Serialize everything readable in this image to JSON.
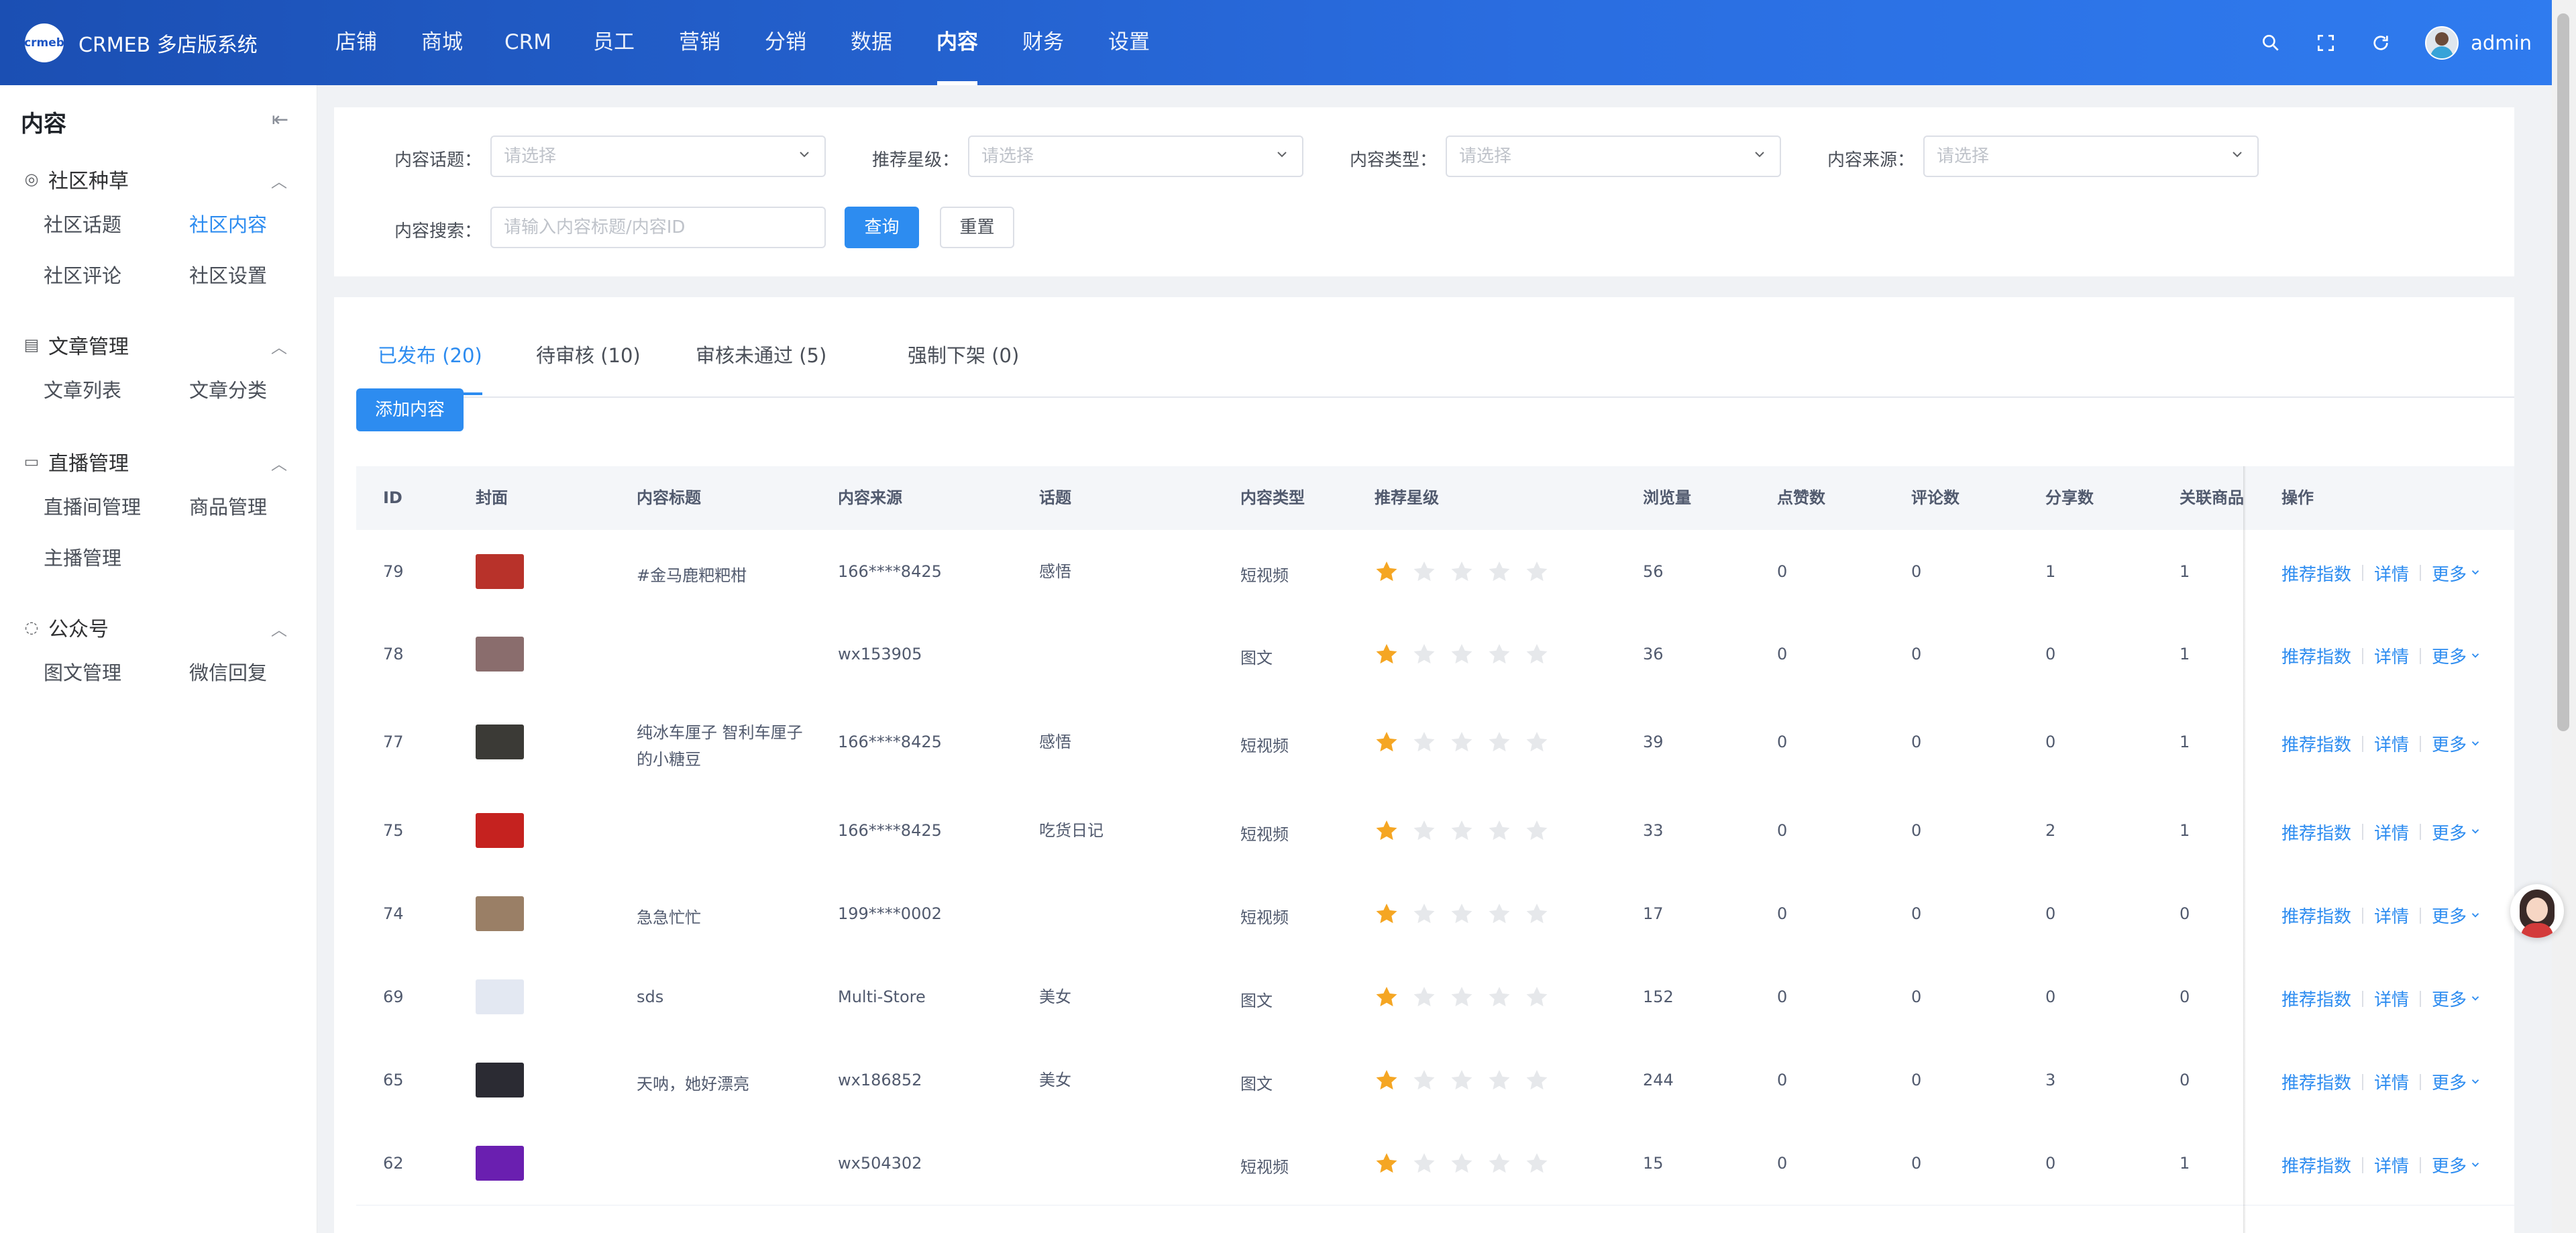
{
  "app": {
    "logo_mark": "crmeb",
    "title": "CRMEB 多店版系统"
  },
  "topnav": [
    "店铺",
    "商城",
    "CRM",
    "员工",
    "营销",
    "分销",
    "数据",
    "内容",
    "财务",
    "设置"
  ],
  "topnav_active": 7,
  "user": {
    "name": "admin"
  },
  "sidebar": {
    "title": "内容",
    "collapse_icon": "⇤",
    "groups": [
      {
        "label": "社区种草",
        "icon": "target-icon",
        "items": [
          "社区话题",
          "社区内容",
          "社区评论",
          "社区设置"
        ],
        "active_index": 1
      },
      {
        "label": "文章管理",
        "icon": "article-icon",
        "items": [
          "文章列表",
          "文章分类"
        ],
        "active_index": -1
      },
      {
        "label": "直播管理",
        "icon": "video-icon",
        "items": [
          "直播间管理",
          "商品管理",
          "主播管理"
        ],
        "active_index": -1
      },
      {
        "label": "公众号",
        "icon": "chat-icon",
        "items": [
          "图文管理",
          "微信回复"
        ],
        "active_index": -1
      }
    ]
  },
  "filters": {
    "topic": {
      "label": "内容话题：",
      "placeholder": "请选择"
    },
    "stars": {
      "label": "推荐星级：",
      "placeholder": "请选择"
    },
    "type": {
      "label": "内容类型：",
      "placeholder": "请选择"
    },
    "source": {
      "label": "内容来源：",
      "placeholder": "请选择"
    },
    "search": {
      "label": "内容搜索：",
      "placeholder": "请输入内容标题/内容ID"
    },
    "query_label": "查询",
    "reset_label": "重置"
  },
  "tabs": [
    "已发布 (20)",
    "待审核 (10)",
    "审核未通过 (5)",
    "强制下架 (0)"
  ],
  "tabs_active": 0,
  "add_button": "添加内容",
  "table": {
    "columns": [
      "ID",
      "封面",
      "内容标题",
      "内容来源",
      "话题",
      "内容类型",
      "推荐星级",
      "浏览量",
      "点赞数",
      "评论数",
      "分享数",
      "关联商品",
      "操作"
    ],
    "op_labels": {
      "recommend": "推荐指数",
      "detail": "详情",
      "more": "更多"
    },
    "rows": [
      {
        "id": "79",
        "title": [
          "#金马鹿粑粑柑"
        ],
        "source": "166****8425",
        "topic": "感悟",
        "type": "短视频",
        "stars": 1,
        "views": "56",
        "likes": "0",
        "comments": "0",
        "shares": "1",
        "goods": "1",
        "cover_color": "#b8322a"
      },
      {
        "id": "78",
        "title": [],
        "source": "wx153905",
        "topic": "",
        "type": "图文",
        "stars": 1,
        "views": "36",
        "likes": "0",
        "comments": "0",
        "shares": "0",
        "goods": "1",
        "cover_color": "#8a6d6d"
      },
      {
        "id": "77",
        "title": [
          "纯冰车厘子 智利车厘子",
          "的小糖豆"
        ],
        "source": "166****8425",
        "topic": "感悟",
        "type": "短视频",
        "stars": 1,
        "views": "39",
        "likes": "0",
        "comments": "0",
        "shares": "0",
        "goods": "1",
        "cover_color": "#3b3a36"
      },
      {
        "id": "75",
        "title": [],
        "source": "166****8425",
        "topic": "吃货日记",
        "type": "短视频",
        "stars": 1,
        "views": "33",
        "likes": "0",
        "comments": "0",
        "shares": "2",
        "goods": "1",
        "cover_color": "#c5221f"
      },
      {
        "id": "74",
        "title": [
          "急急忙忙"
        ],
        "source": "199****0002",
        "topic": "",
        "type": "短视频",
        "stars": 1,
        "views": "17",
        "likes": "0",
        "comments": "0",
        "shares": "0",
        "goods": "0",
        "cover_color": "#9a7f66"
      },
      {
        "id": "69",
        "title": [
          "sds"
        ],
        "source": "Multi-Store",
        "topic": "美女",
        "type": "图文",
        "stars": 1,
        "views": "152",
        "likes": "0",
        "comments": "0",
        "shares": "0",
        "goods": "0",
        "cover_color": "#e3e8f2"
      },
      {
        "id": "65",
        "title": [
          "天呐，她好漂亮"
        ],
        "source": "wx186852",
        "topic": "美女",
        "type": "图文",
        "stars": 1,
        "views": "244",
        "likes": "0",
        "comments": "0",
        "shares": "3",
        "goods": "0",
        "cover_color": "#2b2b33"
      },
      {
        "id": "62",
        "title": [],
        "source": "wx504302",
        "topic": "",
        "type": "短视频",
        "stars": 1,
        "views": "15",
        "likes": "0",
        "comments": "0",
        "shares": "0",
        "goods": "1",
        "cover_color": "#6a1fb0"
      }
    ]
  },
  "colors": {
    "primary": "#2d8cf0",
    "star_on": "#f5a623",
    "star_off": "#e6e8eb",
    "header_from": "#1b4fb3",
    "header_to": "#2f7bef"
  },
  "icons": {
    "search": "search-icon",
    "fullscreen": "fullscreen-icon",
    "refresh": "refresh-icon"
  }
}
